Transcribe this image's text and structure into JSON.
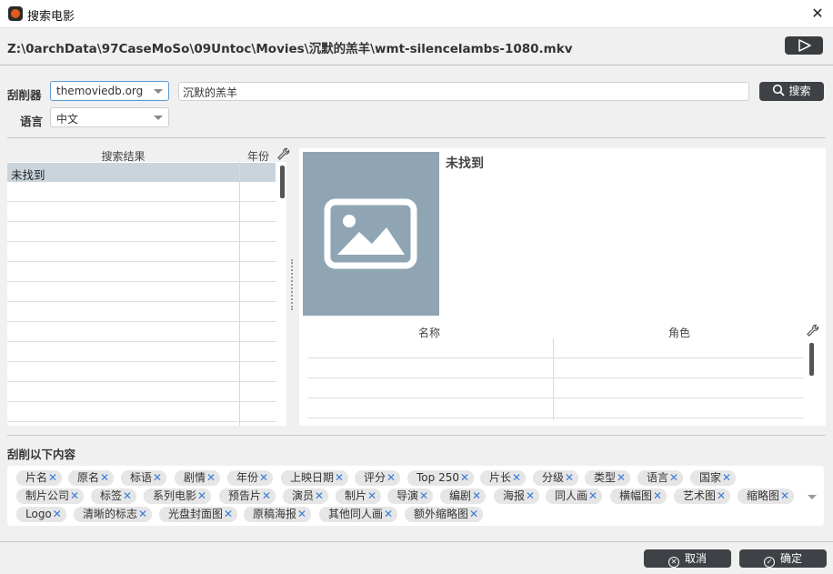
{
  "window": {
    "title": "搜索电影",
    "close_glyph": "✕"
  },
  "file_path": "Z:\\0archData\\97CaseMoSo\\09Untoc\\Movies\\沉默的羔羊\\wmt-silencelambs-1080.mkv",
  "scraper": {
    "label": "刮削器",
    "value": "themoviedb.org"
  },
  "language": {
    "label": "语言",
    "value": "中文"
  },
  "search": {
    "query": "沉默的羔羊",
    "button_label": "搜索"
  },
  "results": {
    "col_title": "搜索结果",
    "col_year": "年份",
    "rows": [
      {
        "title": "未找到",
        "year": ""
      }
    ]
  },
  "detail": {
    "title": "未找到",
    "cast_col_name": "名称",
    "cast_col_role": "角色"
  },
  "scrape_section": {
    "label": "刮削以下内容",
    "tags_row1": [
      "片名",
      "原名",
      "标语",
      "剧情",
      "年份",
      "上映日期",
      "评分",
      "Top 250",
      "片长",
      "分级",
      "类型",
      "语言",
      "国家"
    ],
    "tags_row2": [
      "制片公司",
      "标签",
      "系列电影",
      "预告片",
      "演员",
      "制片",
      "导演",
      "编剧",
      "海报",
      "同人画",
      "横幅图",
      "艺术图",
      "缩略图"
    ],
    "tags_row3": [
      "Logo",
      "清晰的标志",
      "光盘封面图",
      "原稿海报",
      "其他同人画",
      "额外缩略图"
    ],
    "remove_glyph": "✕"
  },
  "footer": {
    "cancel_label": "取消",
    "ok_label": "确定"
  },
  "colors": {
    "accent": "#3a7bd5",
    "button_dark": "#3e4247",
    "poster_placeholder": "#8fa5b4",
    "selected_row": "#c9d4dd"
  }
}
